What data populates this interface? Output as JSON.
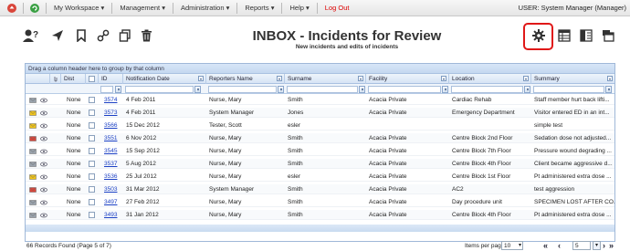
{
  "topbar": {
    "menu": [
      {
        "label": "My Workspace",
        "has_dropdown": true
      },
      {
        "label": "Management",
        "has_dropdown": true
      },
      {
        "label": "Administration",
        "has_dropdown": true
      },
      {
        "label": "Reports",
        "has_dropdown": true
      },
      {
        "label": "Help",
        "has_dropdown": true
      },
      {
        "label": "Log Out",
        "has_dropdown": false
      }
    ],
    "user": "USER: System Manager (Manager)"
  },
  "toolbar": {
    "title": "INBOX - Incidents for Review",
    "subtitle": "New incidents and edits of incidents",
    "left_icons": [
      "user-help-icon",
      "send-icon",
      "bookmark-icon",
      "link-icon",
      "copy-icon",
      "delete-icon"
    ],
    "right_icons": [
      "gear-icon",
      "grid-view-icon",
      "split-view-icon",
      "window-stack-icon"
    ],
    "highlight_color": "#e01818"
  },
  "grid": {
    "group_hint": "Drag a column header here to group by that column",
    "columns": [
      "Dist",
      "ID",
      "Notification Date",
      "Reporters Name",
      "Surname",
      "Facility",
      "Location",
      "Summary"
    ],
    "rows": [
      {
        "icon": "envelope-open",
        "dist": "None",
        "id": "3574",
        "date": "4 Feb 2011",
        "reporter": "Nurse, Mary",
        "surname": "Smith",
        "facility": "Acacia Private",
        "location": "Cardiac Rehab",
        "summary": "Staff member hurt back lifti..."
      },
      {
        "icon": "envelope-yellow",
        "dist": "None",
        "id": "3573",
        "date": "4 Feb 2011",
        "reporter": "System Manager",
        "surname": "Jones",
        "facility": "Acacia Private",
        "location": "Emergency Department",
        "summary": "Visitor entered ED in an int..."
      },
      {
        "icon": "envelope-yellow",
        "dist": "None",
        "id": "3566",
        "date": "15 Dec 2012",
        "reporter": "Tester, Scott",
        "surname": "esler",
        "facility": "",
        "location": "",
        "summary": "simple test"
      },
      {
        "icon": "envelope-red",
        "dist": "None",
        "id": "3551",
        "date": "6 Nov 2012",
        "reporter": "Nurse, Mary",
        "surname": "Smith",
        "facility": "Acacia Private",
        "location": "Centre Block 2nd Floor",
        "summary": "Sedation dose not adjusted..."
      },
      {
        "icon": "envelope-open",
        "dist": "None",
        "id": "3545",
        "date": "15 Sep 2012",
        "reporter": "Nurse, Mary",
        "surname": "Smith",
        "facility": "Acacia Private",
        "location": "Centre Block 7th Floor",
        "summary": "Pressure wound degrading ..."
      },
      {
        "icon": "envelope-open",
        "dist": "None",
        "id": "3537",
        "date": "5 Aug 2012",
        "reporter": "Nurse, Mary",
        "surname": "Smith",
        "facility": "Acacia Private",
        "location": "Centre Block 4th Floor",
        "summary": "Client became aggressive d..."
      },
      {
        "icon": "envelope-yellow",
        "dist": "None",
        "id": "3536",
        "date": "25 Jul 2012",
        "reporter": "Nurse, Mary",
        "surname": "esler",
        "facility": "Acacia Private",
        "location": "Centre Block 1st Floor",
        "summary": "Pt administered extra dose ..."
      },
      {
        "icon": "envelope-red",
        "dist": "None",
        "id": "3503",
        "date": "31 Mar 2012",
        "reporter": "System Manager",
        "surname": "Smith",
        "facility": "Acacia Private",
        "location": "AC2",
        "summary": "test aggression"
      },
      {
        "icon": "envelope-open",
        "dist": "None",
        "id": "3497",
        "date": "27 Feb 2012",
        "reporter": "Nurse, Mary",
        "surname": "Smith",
        "facility": "Acacia Private",
        "location": "Day procedure unit",
        "summary": "SPECIMEN LOST AFTER CO..."
      },
      {
        "icon": "envelope-open",
        "dist": "None",
        "id": "3493",
        "date": "31 Jan 2012",
        "reporter": "Nurse, Mary",
        "surname": "Smith",
        "facility": "Acacia Private",
        "location": "Centre Block 4th Floor",
        "summary": "Pt administered extra dose ..."
      }
    ]
  },
  "footer": {
    "record_count": "66 Records Found (Page 5 of 7)",
    "items_per_page_label": "Items per page:",
    "items_per_page": "10",
    "current_page": "5"
  },
  "colors": {
    "link": "#1a3fc4",
    "header_bg": "#d6e4f5",
    "logout": "#d00000"
  }
}
